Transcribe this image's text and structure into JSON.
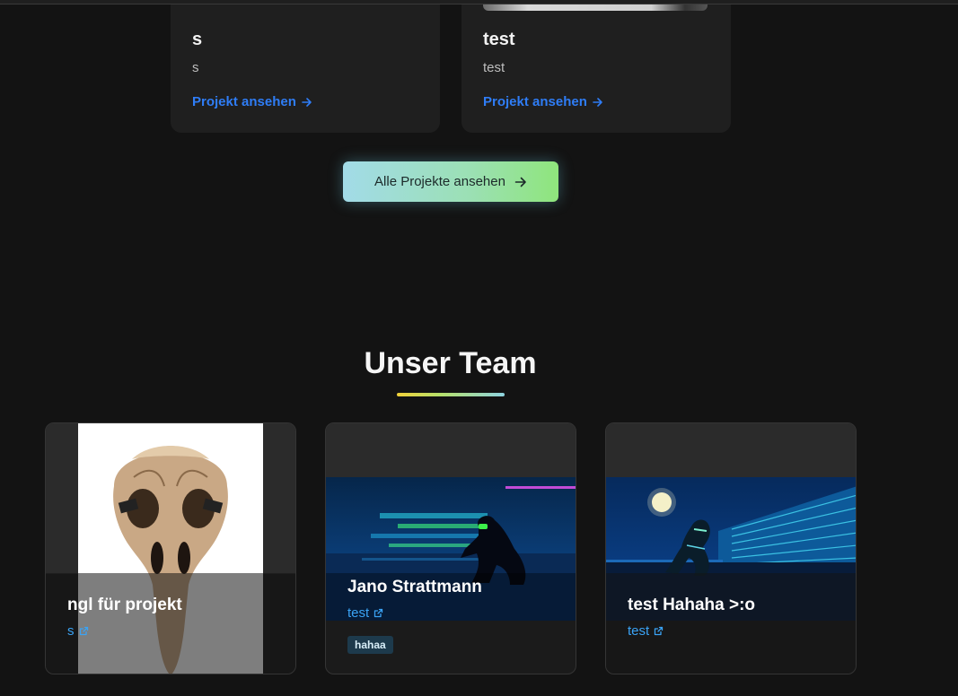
{
  "projects": [
    {
      "title": "s",
      "description": "s",
      "link_label": "Projekt ansehen"
    },
    {
      "title": "test",
      "description": "test",
      "link_label": "Projekt ansehen"
    }
  ],
  "all_projects_button": {
    "label": "Alle Projekte ansehen",
    "icon": "arrow-right-icon"
  },
  "team": {
    "title": "Unser Team",
    "members": [
      {
        "name": "ngl für projekt",
        "link_label": "s",
        "image": "bird-skull-mask",
        "tag": ""
      },
      {
        "name": "Jano Strattmann",
        "link_label": "test",
        "image": "neon-runner-scene",
        "tag": "hahaa"
      },
      {
        "name": "test Hahaha >:o",
        "link_label": "test",
        "image": "neon-night-scene",
        "tag": ""
      }
    ]
  },
  "colors": {
    "background": "#131313",
    "card": "#1f1f1f",
    "link_blue": "#2f7df6",
    "member_link": "#3aa3f5",
    "button_gradient": [
      "#a2dbe8",
      "#8fe57c"
    ],
    "underline_gradient": [
      "#f2d13a",
      "#8ed3e0"
    ]
  }
}
